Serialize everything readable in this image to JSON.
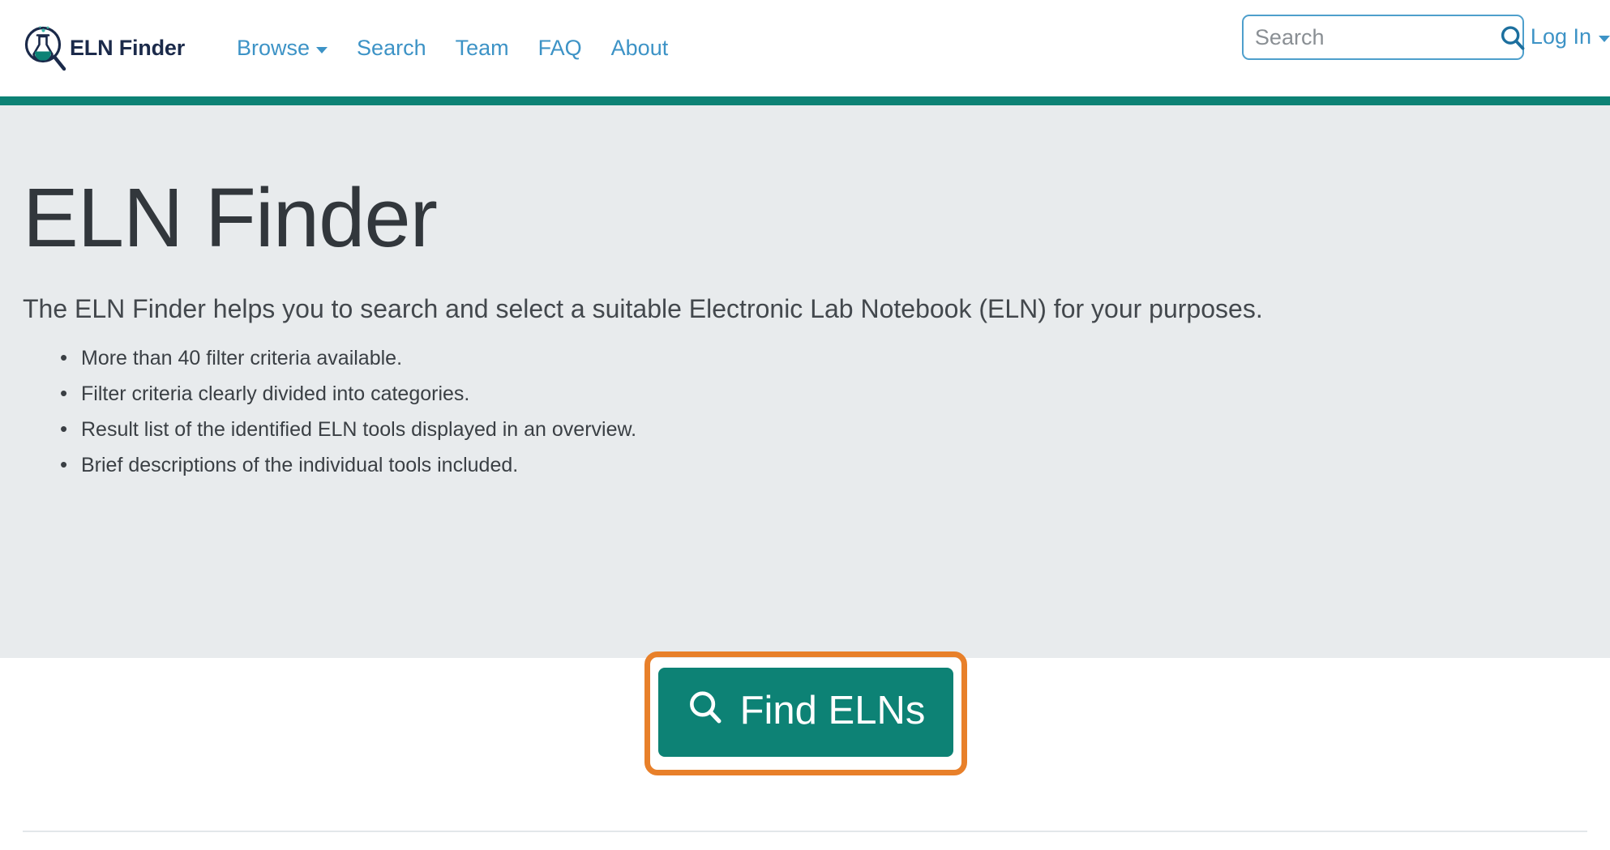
{
  "navbar": {
    "brand": {
      "logo_icon": "flask-magnifier-logo-icon",
      "text": "ELN Finder"
    },
    "links": [
      {
        "label": "Browse",
        "has_caret": true,
        "icon": "chevron-down-icon"
      },
      {
        "label": "Search",
        "has_caret": false,
        "icon": ""
      },
      {
        "label": "Team",
        "has_caret": false,
        "icon": ""
      },
      {
        "label": "FAQ",
        "has_caret": false,
        "icon": ""
      },
      {
        "label": "About",
        "has_caret": false,
        "icon": ""
      }
    ],
    "search": {
      "placeholder": "Search",
      "value": "",
      "icon": "search-icon"
    },
    "login": {
      "label": "Log In",
      "icon": "chevron-down-icon"
    }
  },
  "hero": {
    "title": "ELN Finder",
    "subtitle": "The ELN Finder helps you to search and select a suitable Electronic Lab Notebook (ELN) for your purposes.",
    "bullets": [
      "More than 40 filter criteria available.",
      "Filter criteria clearly divided into categories.",
      "Result list of the identified ELN tools displayed in an overview.",
      "Brief descriptions of the individual tools included."
    ]
  },
  "cta": {
    "button_label": "Find ELNs",
    "button_icon": "search-icon",
    "highlight_annotation": "orange-highlight-box"
  },
  "colors": {
    "teal": "#0d8275",
    "link_blue": "#3d93c6",
    "brand_navy": "#1b2a4a",
    "hero_bg": "#e8ebed",
    "highlight_orange": "#e8802a",
    "text_dark": "#32373c"
  }
}
